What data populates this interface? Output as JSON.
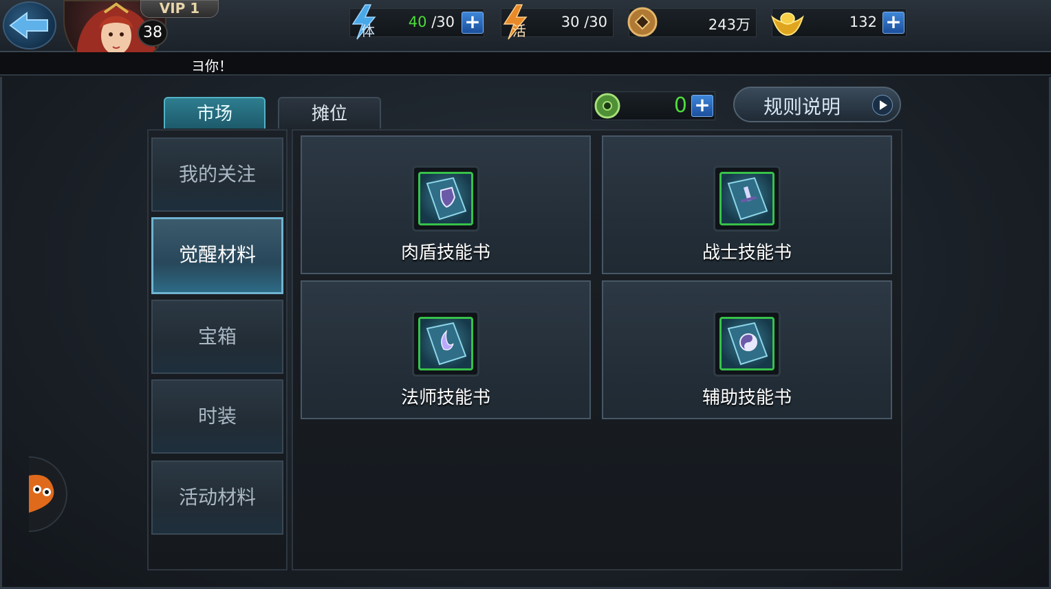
{
  "topbar": {
    "vip_label": "VIP 1",
    "player_level": "38",
    "stamina": {
      "icon_label": "体",
      "current": "40",
      "max": "/30"
    },
    "vitality": {
      "icon_label": "活",
      "value": "30 /30"
    },
    "coins": {
      "value": "243万"
    },
    "gold": {
      "value": "132"
    },
    "plus_symbol": "+"
  },
  "marquee": {
    "text": "ヨ你！"
  },
  "tabs": [
    {
      "label": "市场",
      "active": true
    },
    {
      "label": "摊位",
      "active": false
    }
  ],
  "jade": {
    "value": "0"
  },
  "rules_button": {
    "label": "规则说明"
  },
  "categories": [
    {
      "label": "我的关注",
      "active": false
    },
    {
      "label": "觉醒材料",
      "active": true
    },
    {
      "label": "宝箱",
      "active": false
    },
    {
      "label": "时装",
      "active": false
    },
    {
      "label": "活动材料",
      "active": false
    }
  ],
  "items": [
    {
      "label": "肉盾技能书",
      "icon": "shield-book-icon"
    },
    {
      "label": "战士技能书",
      "icon": "warrior-book-icon"
    },
    {
      "label": "法师技能书",
      "icon": "mage-book-icon"
    },
    {
      "label": "辅助技能书",
      "icon": "support-book-icon"
    }
  ],
  "colors": {
    "accent_green": "#4ddc3a",
    "tab_active": "#2d7d8f",
    "plus_blue": "#3e86d8",
    "item_border": "#37c24a"
  }
}
